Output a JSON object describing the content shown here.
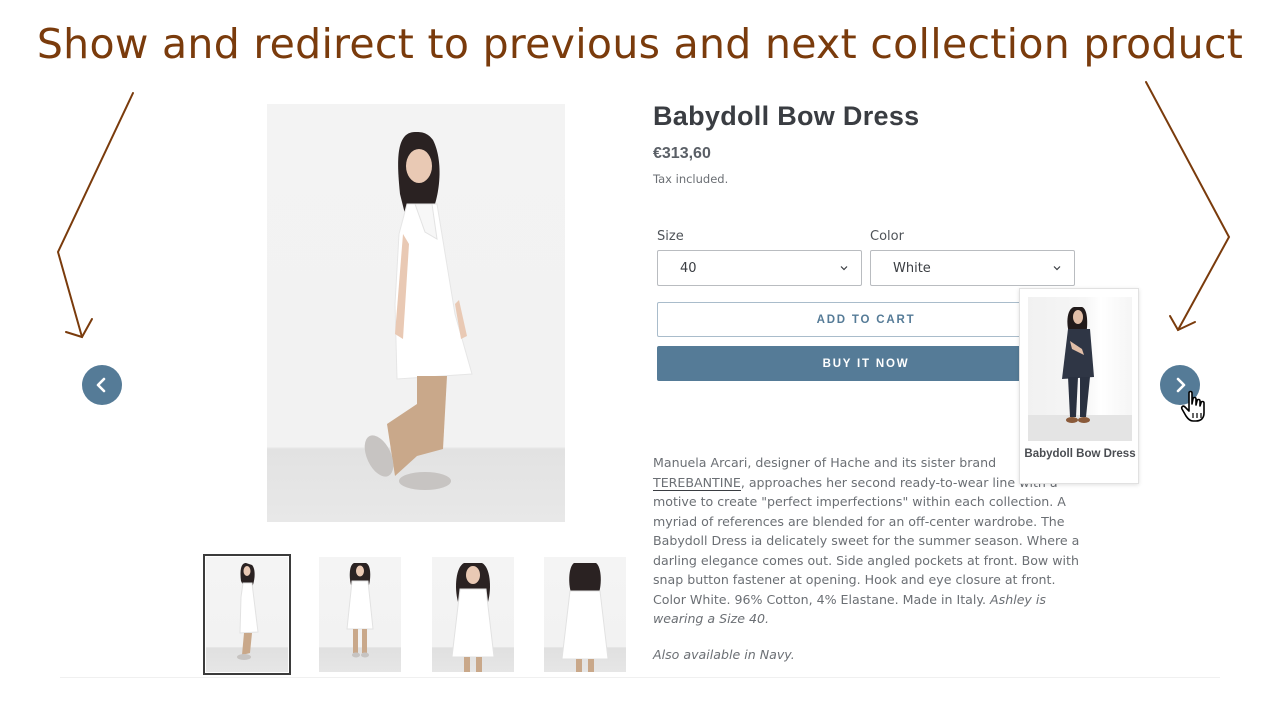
{
  "annotation": {
    "banner_text": "Show and redirect to previous and next collection product",
    "accent_color": "#7a3b0c"
  },
  "theme": {
    "button_color": "#557b97"
  },
  "navigation": {
    "prev_icon": "chevron-left-icon",
    "next_icon": "chevron-right-icon",
    "cursor_icon": "hand-pointer-icon"
  },
  "gallery": {
    "main_image_alt": "Model wearing white Babydoll Bow Dress, side view",
    "thumbnails": [
      {
        "alt": "Side view",
        "active": true
      },
      {
        "alt": "Front full view",
        "active": false
      },
      {
        "alt": "Front close view",
        "active": false
      },
      {
        "alt": "Back view",
        "active": false
      }
    ]
  },
  "product": {
    "title": "Babydoll Bow Dress",
    "price": "€313,60",
    "tax_note": "Tax included.",
    "options": {
      "size": {
        "label": "Size",
        "value": "40"
      },
      "color": {
        "label": "Color",
        "value": "White"
      }
    },
    "add_to_cart_label": "ADD TO CART",
    "buy_now_label": "BUY IT NOW",
    "description": {
      "intro": "Manuela Arcari, designer of Hache and its sister brand ",
      "brand_link": "TEREBANTINE",
      "brand_link_part1": "TE",
      "brand_link_part2": "BANTINE",
      "body": ", approaches her second ready-to-wear line with a motive to create \"perfect imperfections\" within each collection. A myriad of references are blended for an off-center wardrobe. The Babydoll Dress ia delicately sweet for the summer season. Where a darling elegance comes out. Side angled pockets at front. Bow with snap button fastener at opening. Hook and eye closure at front. Color White. 96% Cotton, 4% Elastane. Made in Italy. ",
      "model_note": "Ashley is wearing a Size 40.",
      "availability_note": "Also available in Navy."
    }
  },
  "next_product_preview": {
    "title": "Babydoll Bow Dress",
    "image_alt": "Model wearing navy Babydoll Bow Dress"
  }
}
